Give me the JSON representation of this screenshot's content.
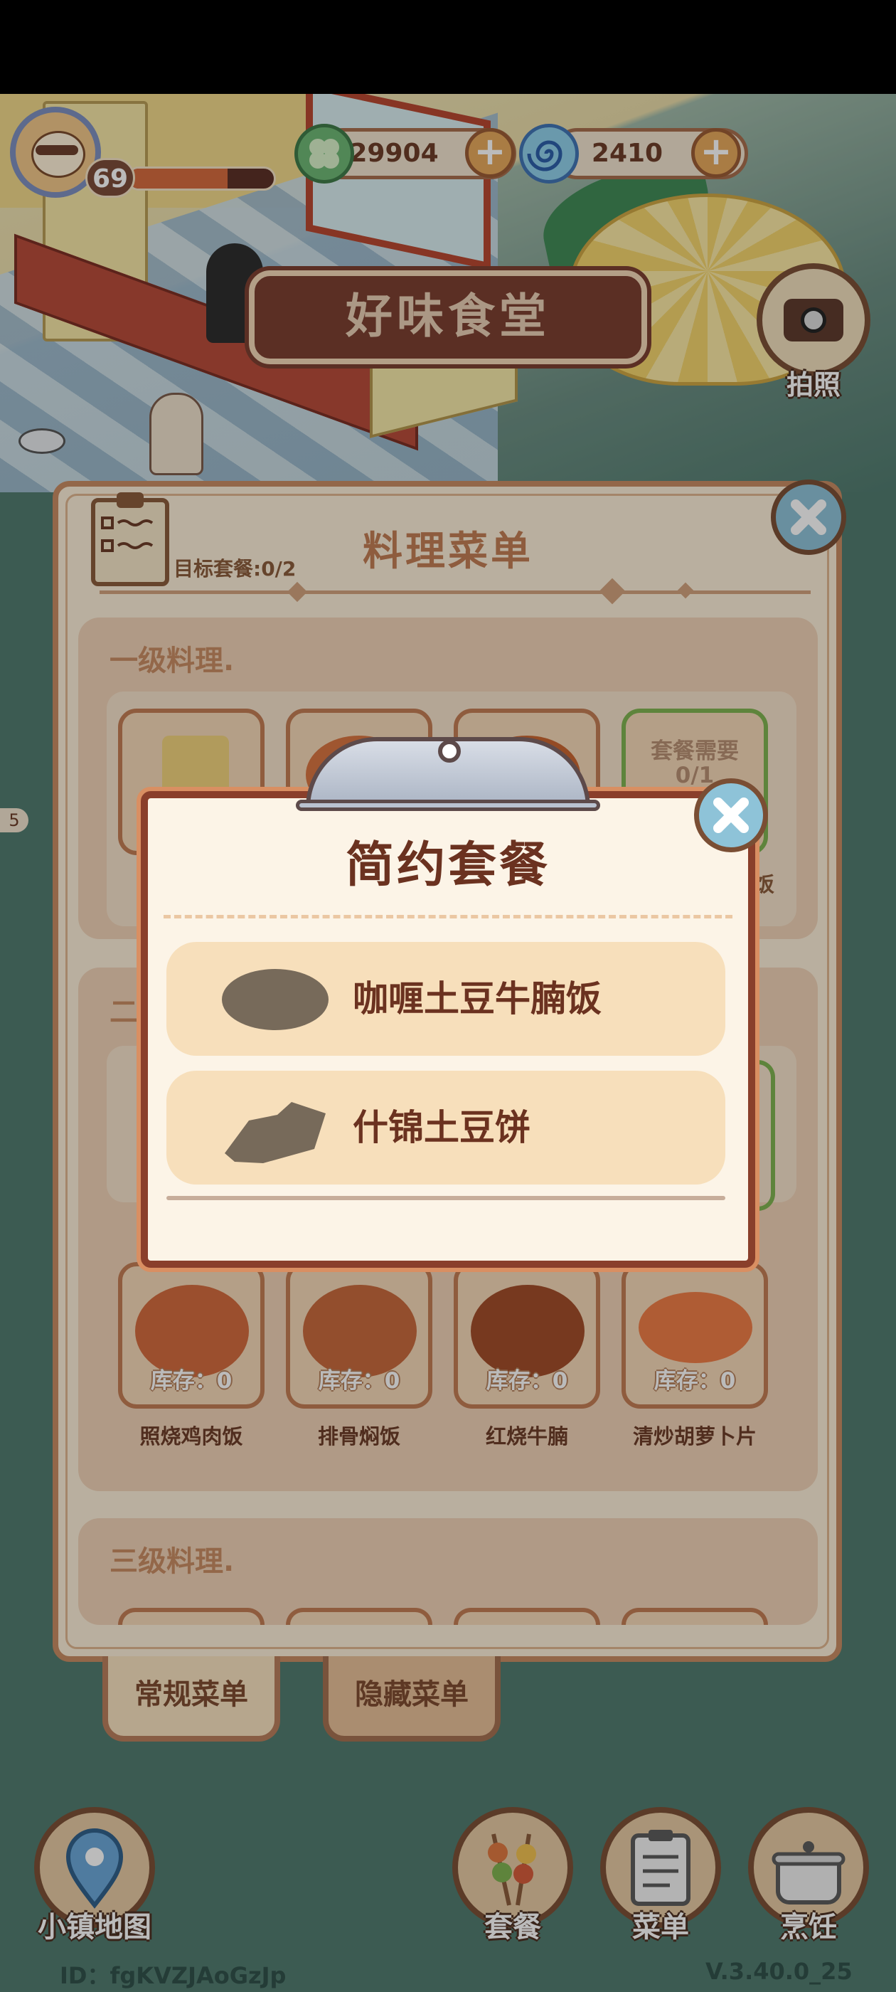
{
  "hud": {
    "level": "69",
    "xp_progress": 0.68,
    "clover_amount": "29904",
    "swirl_amount": "2410",
    "plus_symbol": "+",
    "camera_label": "拍照",
    "restaurant_name": "好味食堂"
  },
  "menu": {
    "title": "料理菜单",
    "target_text": "目标套餐:0/2",
    "section_level1": "一级料理.",
    "section_level2_partial": "二",
    "section_level3": "三级料理.",
    "set_requirement": "套餐需要",
    "set_requirement_count": "0/1",
    "partial_dish_suffix": "饭",
    "level2_dishes": [
      {
        "name": "照烧鸡肉饭",
        "stock": "库存：0"
      },
      {
        "name": "排骨焖饭",
        "stock": "库存：0"
      },
      {
        "name": "红烧牛腩",
        "stock": "库存：0"
      },
      {
        "name": "清炒胡萝卜片",
        "stock": "库存：0"
      }
    ],
    "partial_left_count": "5"
  },
  "tabs": {
    "regular": "常规菜单",
    "hidden": "隐藏菜单"
  },
  "bottom_nav": {
    "map": "小镇地图",
    "sets": "套餐",
    "menu": "菜单",
    "cook": "烹饪"
  },
  "footer": {
    "id": "ID：fgKVZJAoGzJp",
    "version": "V.3.40.0_25"
  },
  "popup": {
    "title": "简约套餐",
    "items": [
      {
        "name": "咖喱土豆牛腩饭"
      },
      {
        "name": "什锦土豆饼"
      }
    ]
  },
  "colors": {
    "brown_dark": "#6b3220",
    "accent_orange": "#c17c52",
    "green_border": "#7fb34f"
  }
}
